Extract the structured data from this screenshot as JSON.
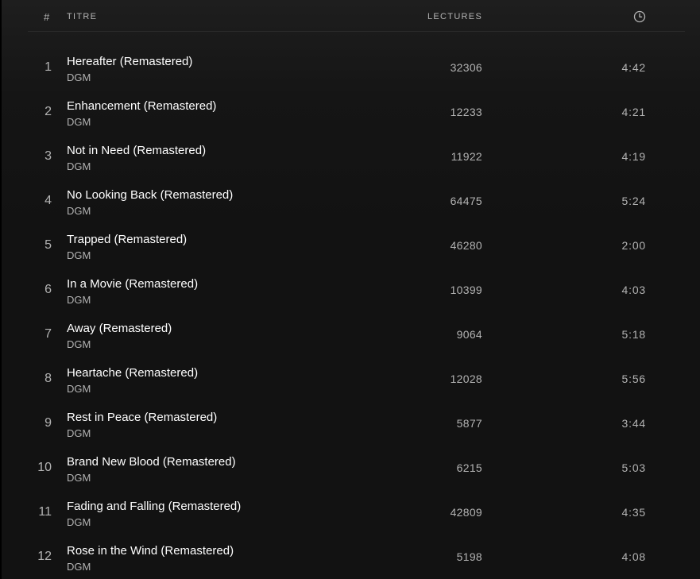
{
  "header": {
    "number_label": "#",
    "title_label": "TITRE",
    "plays_label": "LECTURES",
    "duration_icon": "clock-icon"
  },
  "colors": {
    "background": "#121212",
    "text_primary": "#ffffff",
    "text_secondary": "#b3b3b3"
  },
  "tracks": [
    {
      "number": "1",
      "title": "Hereafter (Remastered)",
      "artist": "DGM",
      "plays": "32306",
      "duration": "4:42"
    },
    {
      "number": "2",
      "title": "Enhancement (Remastered)",
      "artist": "DGM",
      "plays": "12233",
      "duration": "4:21"
    },
    {
      "number": "3",
      "title": "Not in Need (Remastered)",
      "artist": "DGM",
      "plays": "11922",
      "duration": "4:19"
    },
    {
      "number": "4",
      "title": "No Looking Back (Remastered)",
      "artist": "DGM",
      "plays": "64475",
      "duration": "5:24"
    },
    {
      "number": "5",
      "title": "Trapped (Remastered)",
      "artist": "DGM",
      "plays": "46280",
      "duration": "2:00"
    },
    {
      "number": "6",
      "title": "In a Movie (Remastered)",
      "artist": "DGM",
      "plays": "10399",
      "duration": "4:03"
    },
    {
      "number": "7",
      "title": "Away (Remastered)",
      "artist": "DGM",
      "plays": "9064",
      "duration": "5:18"
    },
    {
      "number": "8",
      "title": "Heartache (Remastered)",
      "artist": "DGM",
      "plays": "12028",
      "duration": "5:56"
    },
    {
      "number": "9",
      "title": "Rest in Peace (Remastered)",
      "artist": "DGM",
      "plays": "5877",
      "duration": "3:44"
    },
    {
      "number": "10",
      "title": "Brand New Blood (Remastered)",
      "artist": "DGM",
      "plays": "6215",
      "duration": "5:03"
    },
    {
      "number": "11",
      "title": "Fading and Falling (Remastered)",
      "artist": "DGM",
      "plays": "42809",
      "duration": "4:35"
    },
    {
      "number": "12",
      "title": "Rose in the Wind (Remastered)",
      "artist": "DGM",
      "plays": "5198",
      "duration": "4:08"
    }
  ]
}
